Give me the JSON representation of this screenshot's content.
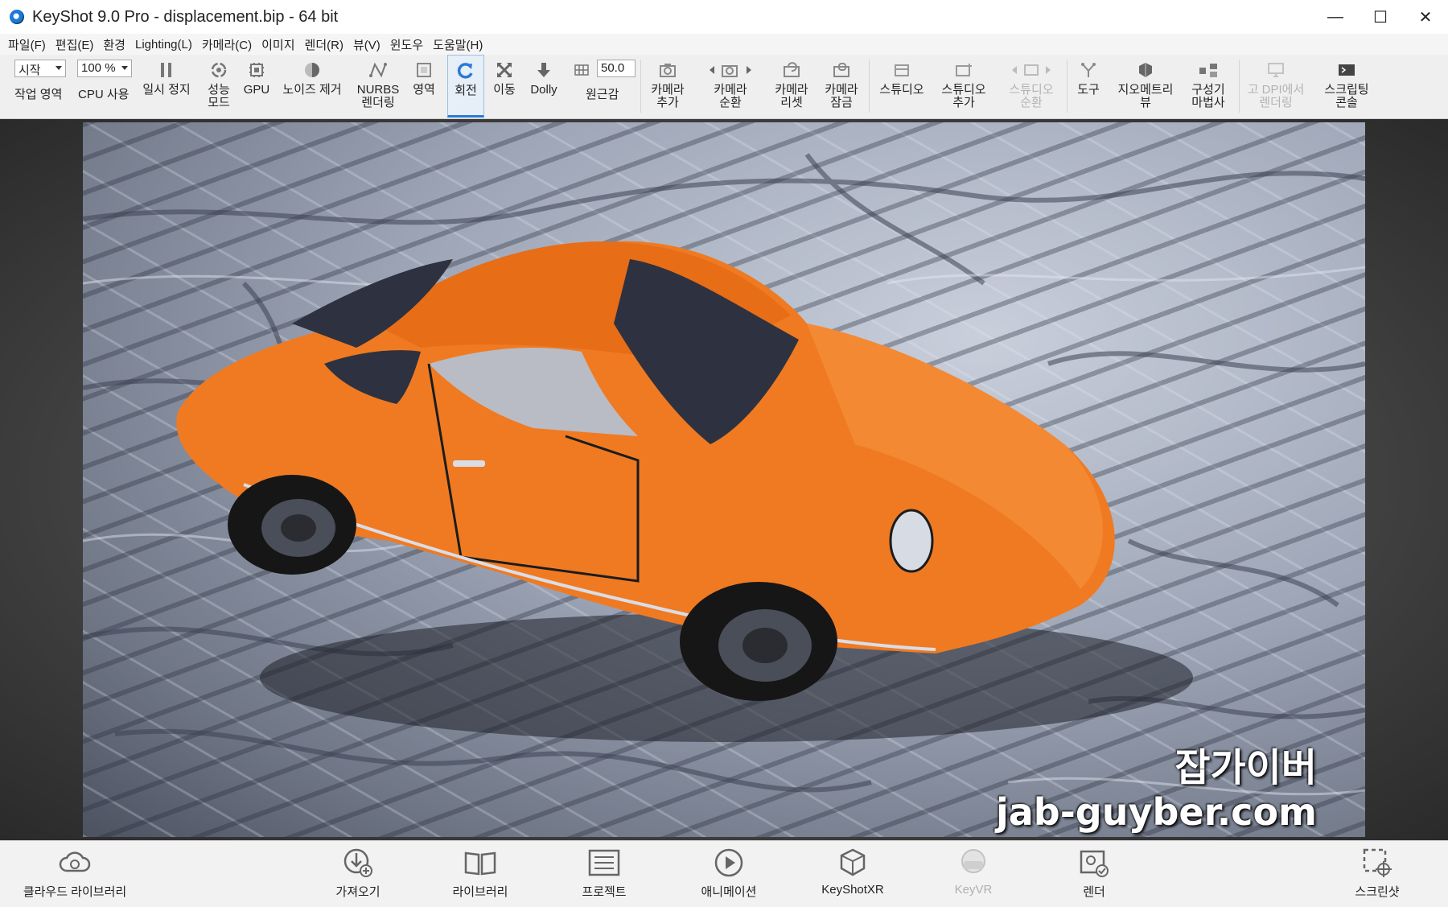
{
  "window": {
    "title": "KeyShot 9.0 Pro  - displacement.bip  - 64 bit",
    "minimize": "—",
    "maximize": "☐",
    "close": "✕"
  },
  "menu": [
    "파일(F)",
    "편집(E)",
    "환경",
    "Lighting(L)",
    "카메라(C)",
    "이미지",
    "렌더(R)",
    "뷰(V)",
    "윈도우",
    "도움말(H)"
  ],
  "toolbar": {
    "workspace_select": "시작",
    "workspace_label": "작업 영역",
    "cpu_select": "100 %",
    "cpu_label": "CPU 사용",
    "pause": "일시 정지",
    "perf_mode": "성능\n모드",
    "gpu": "GPU",
    "denoise": "노이즈 제거",
    "nurbs": "NURBS\n렌더링",
    "region": "영역",
    "rotate": "회전",
    "pan": "이동",
    "dolly": "Dolly",
    "perspective_value": "50.0",
    "perspective": "원근감",
    "add_camera": "카메라\n추가",
    "cycle_camera": "카메라\n순환",
    "reset_camera": "카메라\n리셋",
    "lock_camera": "카메라\n잠금",
    "studio": "스튜디오",
    "add_studio": "스튜디오\n추가",
    "cycle_studio": "스튜디오\n순환",
    "tools": "도구",
    "geometry_view": "지오메트리\n뷰",
    "config_wizard": "구성기\n마법사",
    "high_dpi": "고 DPI에서\n렌더링",
    "script_console": "스크립팅\n콘솔"
  },
  "watermark": {
    "line1": "잡가이버",
    "line2": "jab-guyber.com"
  },
  "bottombar": {
    "cloud_library": "클라우드 라이브러리",
    "import": "가져오기",
    "library": "라이브러리",
    "project": "프로젝트",
    "animation": "애니메이션",
    "keyshotxr": "KeyShotXR",
    "keyvr": "KeyVR",
    "render": "렌더",
    "screenshot": "스크린샷"
  },
  "colors": {
    "accent": "#2a7ad6",
    "car_body": "#f07a22",
    "disabled_text": "#b3b3b3"
  }
}
